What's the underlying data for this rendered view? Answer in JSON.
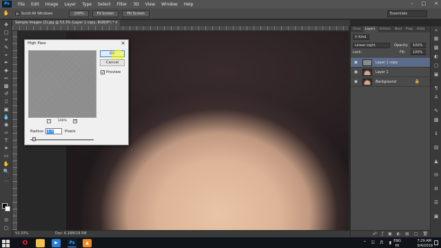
{
  "app": {
    "logo": "Ps",
    "menu": [
      "File",
      "Edit",
      "Image",
      "Layer",
      "Type",
      "Select",
      "Filter",
      "3D",
      "View",
      "Window",
      "Help"
    ]
  },
  "options_bar": {
    "scroll_all_windows": "Scroll All Windows",
    "zoom_100": "100%",
    "fit_screen": "Fit Screen",
    "fill_screen": "Fill Screen",
    "workspace": "Essentials"
  },
  "document": {
    "tab_title": "Sample Images (2).jpg @ 53.3% (Layer 1 copy, RGB/8*) *",
    "tab_close": "×"
  },
  "status_bar": {
    "zoom": "53.33%",
    "doc_size": "Doc: 6.18M/18.5M"
  },
  "dialog": {
    "title": "High Pass",
    "close": "×",
    "ok": "OK",
    "cancel": "Cancel",
    "preview_checked": true,
    "preview_label": "Preview",
    "preview_zoom": "100%",
    "zoom_out": "−",
    "zoom_in": "+",
    "radius_label": "Radius:",
    "radius_value": "1.7",
    "pixels_label": "Pixels"
  },
  "layers_panel": {
    "tabs": [
      "Chan",
      "Layers",
      "Actions",
      "Navi",
      "Prop",
      "Histo"
    ],
    "active_tab": "Layers",
    "kind": "Kind",
    "blend_mode": "Linear Light",
    "opacity_label": "Opacity:",
    "opacity": "100%",
    "lock_label": "Lock:",
    "fill_label": "Fill:",
    "fill": "100%",
    "layers": [
      {
        "name": "Layer 1 copy",
        "selected": true,
        "thumb": "gray",
        "italic": false,
        "locked": false
      },
      {
        "name": "Layer 1",
        "selected": false,
        "thumb": "face",
        "italic": false,
        "locked": false
      },
      {
        "name": "Background",
        "selected": false,
        "thumb": "face",
        "italic": true,
        "locked": true
      }
    ]
  },
  "taskbar": {
    "language": "ENG",
    "region": "IN",
    "time": "7:29 AM",
    "date": "9/4/2019",
    "apps": [
      "opera",
      "file-explorer",
      "media-app",
      "photoshop",
      "vlc"
    ]
  },
  "colors": {
    "accent": "#31a8ff",
    "selected_layer": "#5b6b8a",
    "foreground": "#000000",
    "background": "#ffffff"
  }
}
